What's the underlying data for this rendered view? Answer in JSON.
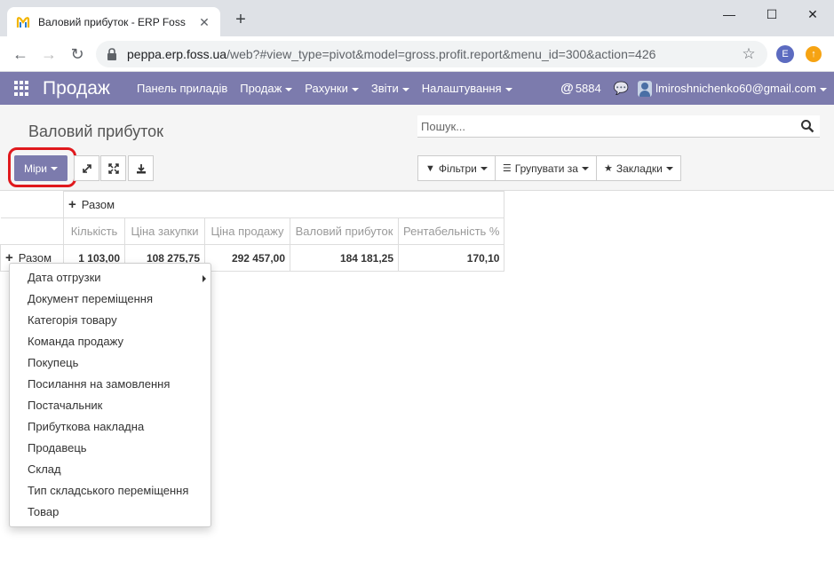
{
  "browser": {
    "tab_title": "Валовий прибуток - ERP Foss",
    "url_host": "peppa.erp.foss.ua",
    "url_path": "/web?#view_type=pivot&model=gross.profit.report&menu_id=300&action=426",
    "profile_initial": "E"
  },
  "navbar": {
    "brand": "Продаж",
    "menu": [
      "Панель приладів",
      "Продаж",
      "Рахунки",
      "Звіти",
      "Налаштування"
    ],
    "mentions": "5884",
    "user": "lmiroshnichenko60@gmail.com",
    "bg_color": "#7c7bad"
  },
  "control_panel": {
    "title": "Валовий прибуток",
    "search_placeholder": "Пошук...",
    "measures_label": "Міри",
    "filters_label": "Фільтри",
    "groupby_label": "Групувати за",
    "favorites_label": "Закладки"
  },
  "pivot": {
    "col_total_label": "Разом",
    "row_total_label": "Разом",
    "measures": [
      "Кількість",
      "Ціна закупки",
      "Ціна продажу",
      "Валовий прибуток",
      "Рентабельність %"
    ],
    "values": [
      "1 103,00",
      "108 275,75",
      "292 457,00",
      "184 181,25",
      "170,10"
    ]
  },
  "groupby_dropdown": {
    "items": [
      "Дата отгрузки",
      "Документ переміщення",
      "Категорія товару",
      "Команда продажу",
      "Покупець",
      "Посилання на замовлення",
      "Постачальник",
      "Прибуткова накладна",
      "Продавець",
      "Склад",
      "Тип складського переміщення",
      "Товар"
    ]
  }
}
